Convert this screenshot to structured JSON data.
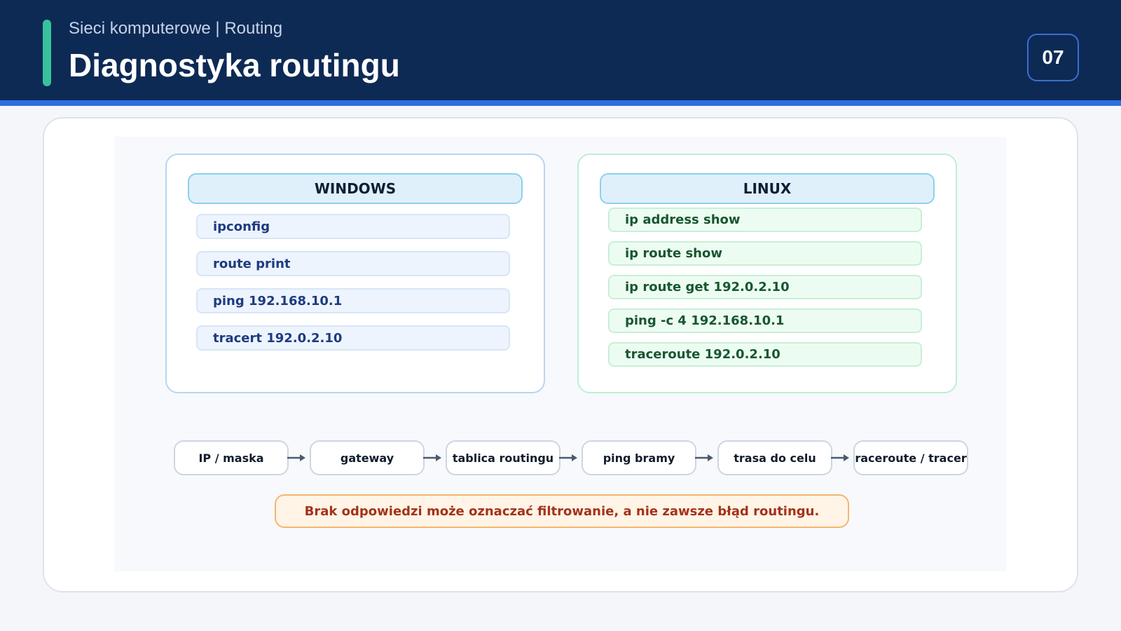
{
  "header": {
    "subtitle": "Sieci komputerowe | Routing",
    "title": "Diagnostyka routingu",
    "page_number": "07"
  },
  "windows": {
    "title": "WINDOWS",
    "commands": [
      "ipconfig",
      "route print",
      "ping 192.168.10.1",
      "tracert 192.0.2.10"
    ]
  },
  "linux": {
    "title": "LINUX",
    "commands": [
      "ip address show",
      "ip route show",
      "ip route get 192.0.2.10",
      "ping -c 4 192.168.10.1",
      "traceroute 192.0.2.10"
    ]
  },
  "flow": {
    "steps": [
      "IP / maska",
      "gateway",
      "tablica routingu",
      "ping bramy",
      "trasa do celu",
      "traceroute / tracert"
    ]
  },
  "note": "Brak odpowiedzi może oznaczać filtrowanie, a nie zawsze błąd routingu.",
  "colors": {
    "header_bg": "#0d2a55",
    "accent": "#37c29b",
    "stripe": "#2d6fe0",
    "windows_text": "#1d3b80",
    "linux_text": "#17572f",
    "note_text": "#a4321b"
  }
}
